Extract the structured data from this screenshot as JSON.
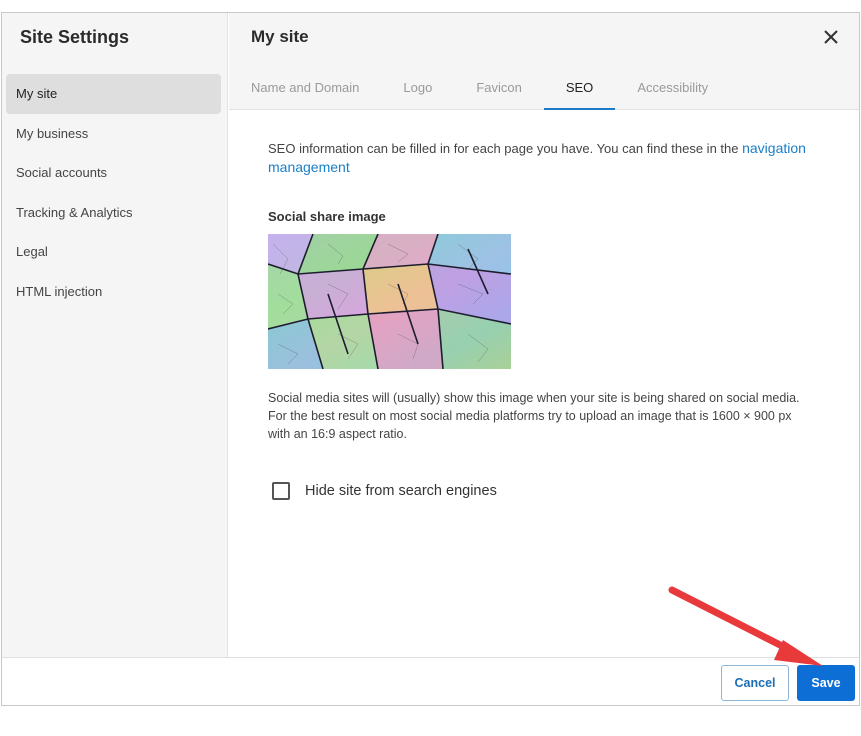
{
  "sidebar": {
    "title": "Site Settings",
    "items": [
      {
        "label": "My site"
      },
      {
        "label": "My business"
      },
      {
        "label": "Social accounts"
      },
      {
        "label": "Tracking & Analytics"
      },
      {
        "label": "Legal"
      },
      {
        "label": "HTML injection"
      }
    ],
    "active_index": 0
  },
  "header": {
    "title": "My site",
    "close_icon": "close-icon",
    "tabs": [
      {
        "label": "Name and Domain"
      },
      {
        "label": "Logo"
      },
      {
        "label": "Favicon"
      },
      {
        "label": "SEO"
      },
      {
        "label": "Accessibility"
      }
    ],
    "active_tab": "SEO"
  },
  "seo": {
    "info_text": "SEO information can be filled in for each page you have. You can find these in the ",
    "info_link": "navigation management",
    "share_image_label": "Social share image",
    "share_image_help": "Social media sites will (usually) show this image when your site is being shared on social media. For the best result on most social media platforms try to upload an image that is 1600 × 900 px with an 16:9 aspect ratio.",
    "hide_checkbox_label": "Hide site from search engines",
    "hide_checkbox_checked": false
  },
  "footer": {
    "cancel_label": "Cancel",
    "save_label": "Save"
  },
  "colors": {
    "accent": "#0d6fd6",
    "link": "#1a7fc7",
    "annotation_arrow": "#e8393b"
  }
}
